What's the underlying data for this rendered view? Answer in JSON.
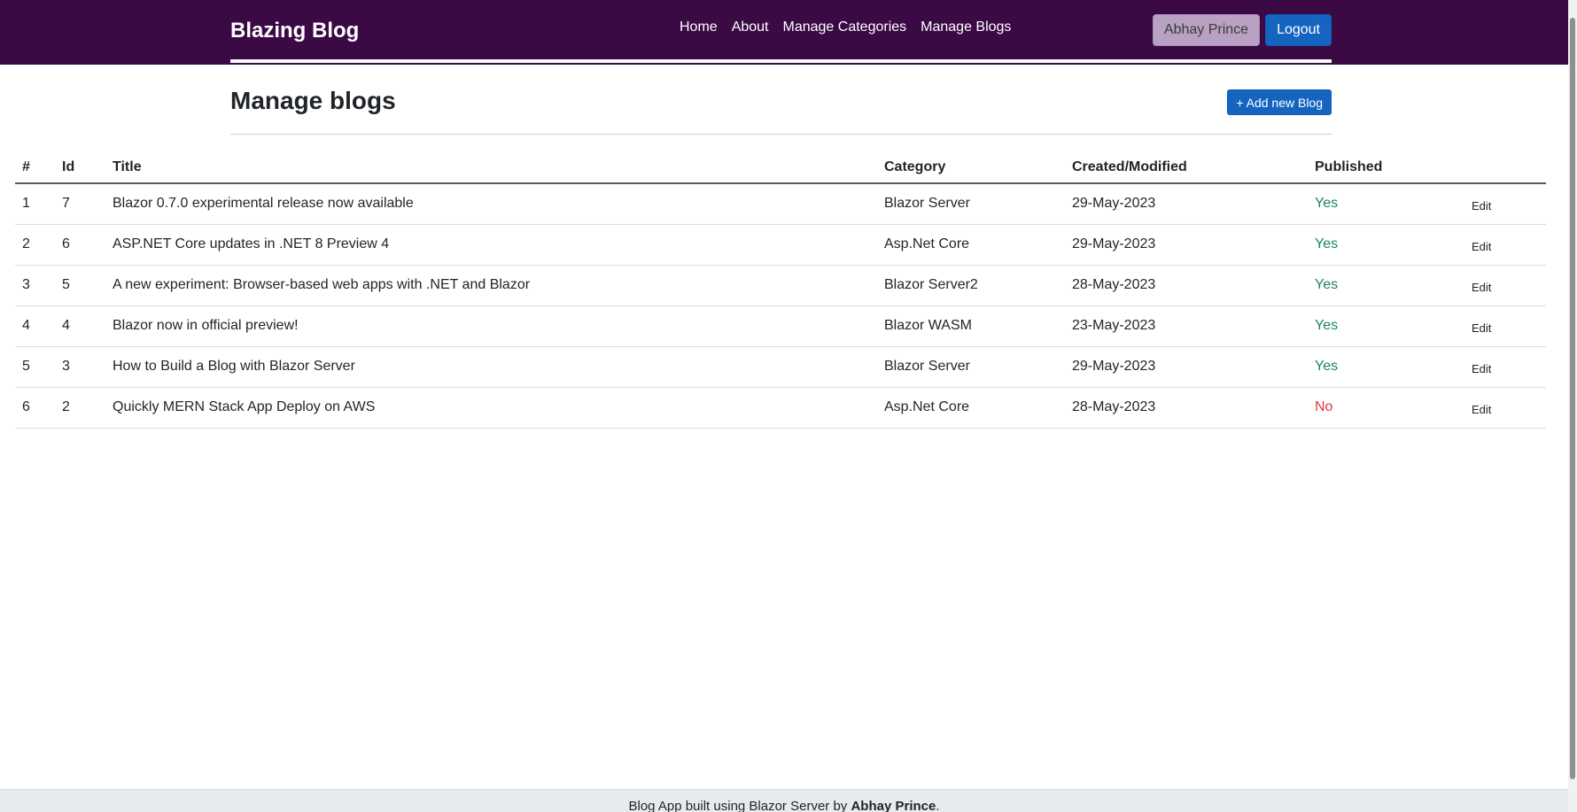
{
  "navbar": {
    "brand": "Blazing Blog",
    "links": [
      "Home",
      "About",
      "Manage Categories",
      "Manage Blogs"
    ],
    "user_label": "Abhay Prince",
    "logout_label": "Logout"
  },
  "page": {
    "title": "Manage blogs",
    "add_button": "+ Add new Blog"
  },
  "table": {
    "headers": [
      "#",
      "Id",
      "Title",
      "Category",
      "Created/Modified",
      "Published",
      ""
    ],
    "rows": [
      {
        "num": "1",
        "id": "7",
        "title": "Blazor 0.7.0 experimental release now available",
        "category": "Blazor Server",
        "date": "29-May-2023",
        "published": "Yes",
        "action": "Edit"
      },
      {
        "num": "2",
        "id": "6",
        "title": "ASP.NET Core updates in .NET 8 Preview 4",
        "category": "Asp.Net Core",
        "date": "29-May-2023",
        "published": "Yes",
        "action": "Edit"
      },
      {
        "num": "3",
        "id": "5",
        "title": "A new experiment: Browser-based web apps with .NET and Blazor",
        "category": "Blazor Server2",
        "date": "28-May-2023",
        "published": "Yes",
        "action": "Edit"
      },
      {
        "num": "4",
        "id": "4",
        "title": "Blazor now in official preview!",
        "category": "Blazor WASM",
        "date": "23-May-2023",
        "published": "Yes",
        "action": "Edit"
      },
      {
        "num": "5",
        "id": "3",
        "title": "How to Build a Blog with Blazor Server",
        "category": "Blazor Server",
        "date": "29-May-2023",
        "published": "Yes",
        "action": "Edit"
      },
      {
        "num": "6",
        "id": "2",
        "title": "Quickly MERN Stack App Deploy on AWS",
        "category": "Asp.Net Core",
        "date": "28-May-2023",
        "published": "No",
        "action": "Edit"
      }
    ]
  },
  "footer": {
    "text_prefix": "Blog App built using Blazor Server by ",
    "author": "Abhay Prince",
    "text_suffix": "."
  },
  "colors": {
    "navbar_bg": "#3b0a45",
    "primary": "#1565c0",
    "published_yes": "#198754",
    "published_no": "#dc3545"
  }
}
